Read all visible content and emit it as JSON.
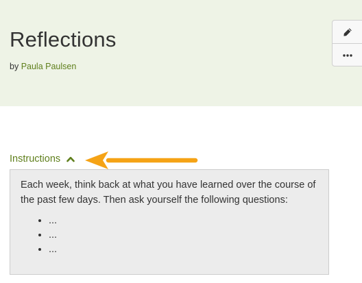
{
  "header": {
    "title": "Reflections",
    "byline_prefix": "by",
    "author": "Paula Paulsen"
  },
  "toolbar": {
    "edit_icon": "pencil-icon",
    "more_icon": "more-horizontal-icon"
  },
  "instructions": {
    "toggle_label": "Instructions",
    "toggle_icon": "chevron-up-icon",
    "text": "Each week, think back at what you have learned over the course of the past few days. Then ask yourself the following questions:",
    "items": [
      "...",
      "...",
      "..."
    ]
  },
  "colors": {
    "header_bg": "#eef3e6",
    "link": "#5f7f1c",
    "arrow": "#f5a316",
    "box_bg": "#ececec"
  }
}
